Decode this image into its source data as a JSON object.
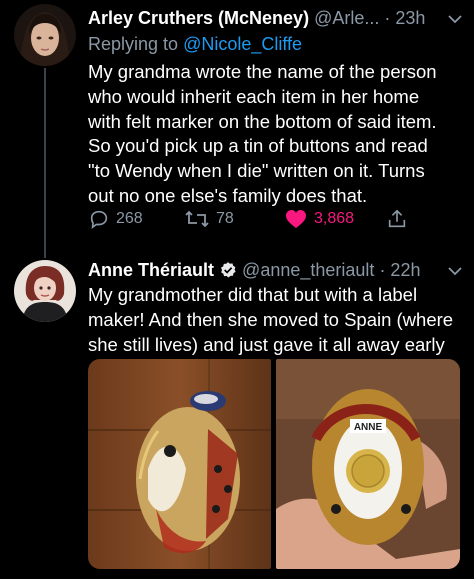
{
  "tweet1": {
    "display_name": "Arley Cruthers (McNeney)",
    "handle": "@Arle...",
    "time": "· 23h",
    "reply_prefix": "Replying to",
    "reply_handle": "@Nicole_Cliffe",
    "text_lines": [
      "My grandma wrote the name of the person",
      "who would inherit each item in her home",
      "with felt marker on the bottom of said item.",
      "So you'd pick up a tin of buttons and read",
      "\"to Wendy when I die\" written on it. Turns",
      "out no one else's family does that."
    ],
    "replies": "268",
    "retweets": "78",
    "likes": "3,868"
  },
  "tweet2": {
    "display_name": "Anne Thériault",
    "handle": "@anne_theriault",
    "time": "· 22h",
    "text_lines": [
      "My grandmother did that but with a label",
      "maker! And then she moved to Spain (where",
      "she still lives) and just gave it all away early"
    ],
    "photo_label": "ANNE"
  },
  "colors": {
    "background": "#000000",
    "text": "#ffffff",
    "muted": "#8b98a5",
    "link": "#1d9bf0",
    "like": "#f91880"
  },
  "icons": [
    "chevron-down-icon",
    "reply-icon",
    "retweet-icon",
    "heart-icon",
    "share-icon",
    "verified-badge-icon"
  ]
}
